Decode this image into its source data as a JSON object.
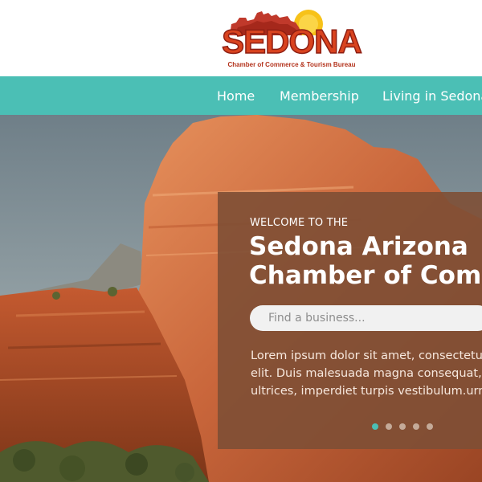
{
  "brand": {
    "name": "SEDONA",
    "tagline": "Chamber of Commerce & Tourism Bureau"
  },
  "colors": {
    "accent": "#4bbfb5",
    "panel": "#7e4f35",
    "logo_red": "#d9431f"
  },
  "nav": {
    "items": [
      {
        "label": "Home"
      },
      {
        "label": "Membership"
      },
      {
        "label": "Living in Sedona"
      }
    ]
  },
  "hero": {
    "eyebrow": "WELCOME TO THE",
    "title_line1": "Sedona Arizona",
    "title_line2": "Chamber of Commerce",
    "search_placeholder": "Find a business...",
    "body_lines": [
      "Lorem ipsum dolor sit amet, consectetur adipiscing",
      "elit. Duis malesuada magna consequat, ornare",
      "ultrices, imperdiet turpis vestibulum.urna."
    ],
    "slides_total": 5,
    "active_slide": 1
  }
}
